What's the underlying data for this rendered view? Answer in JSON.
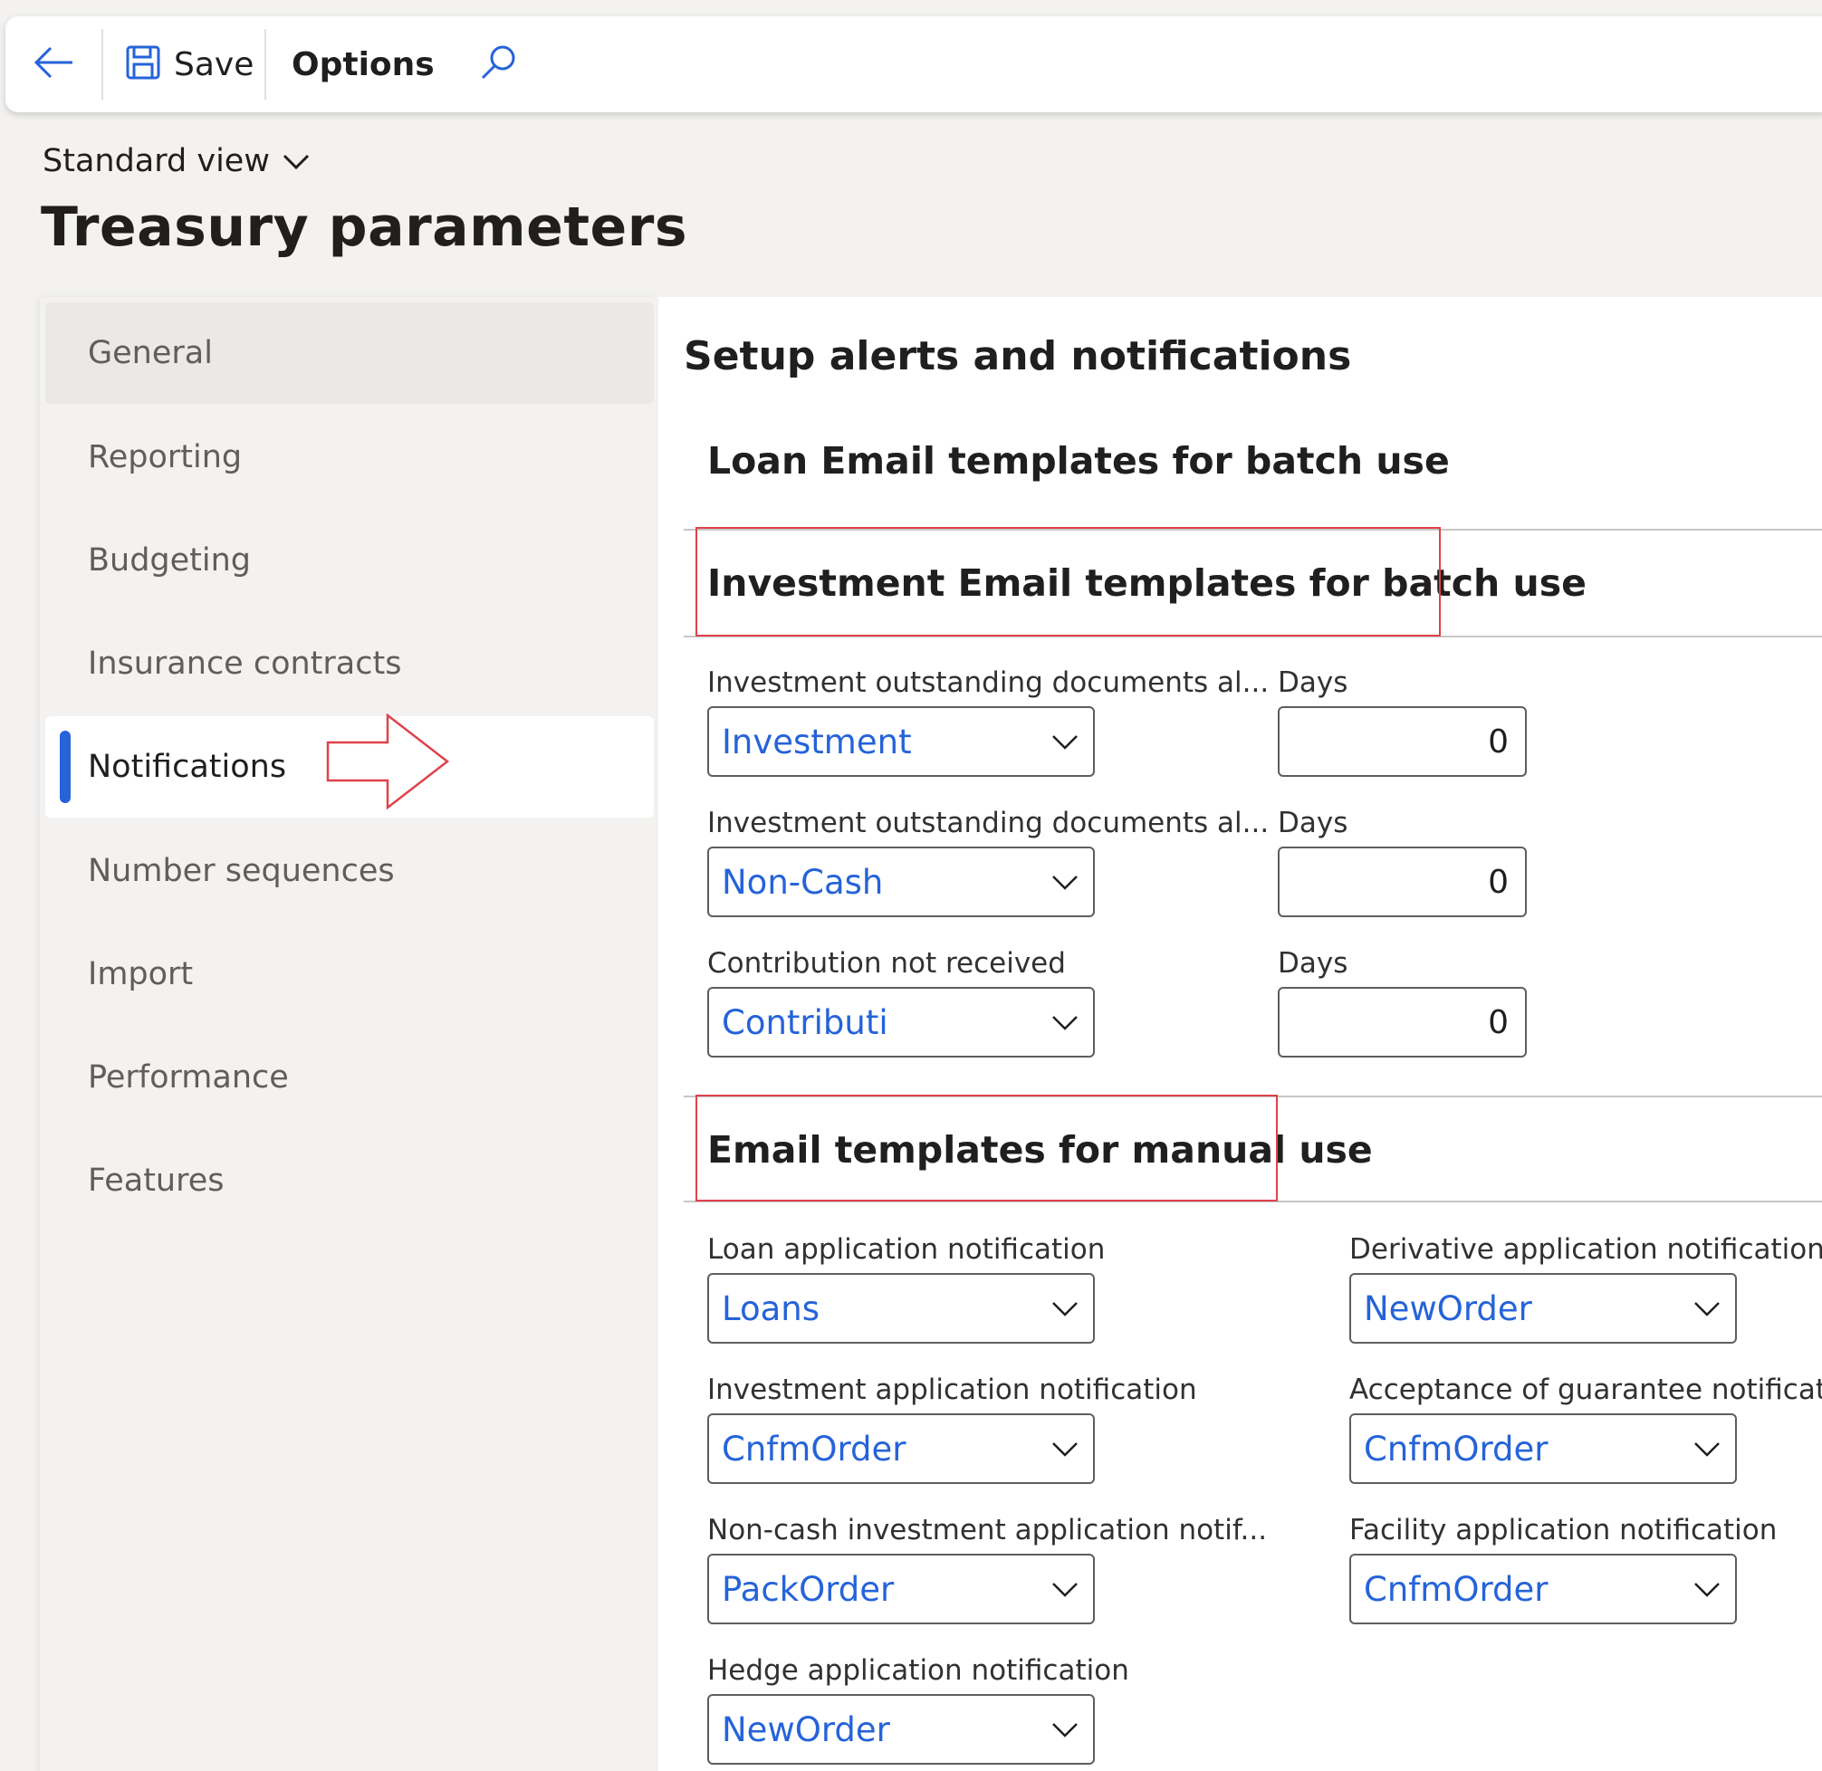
{
  "toolbar": {
    "back": "back-arrow",
    "save_label": "Save",
    "options_label": "Options",
    "search": "search-icon"
  },
  "view": {
    "label": "Standard view"
  },
  "page": {
    "title": "Treasury parameters"
  },
  "nav": {
    "items": [
      {
        "label": "General"
      },
      {
        "label": "Reporting"
      },
      {
        "label": "Budgeting"
      },
      {
        "label": "Insurance contracts"
      },
      {
        "label": "Notifications"
      },
      {
        "label": "Number sequences"
      },
      {
        "label": "Import"
      },
      {
        "label": "Performance"
      },
      {
        "label": "Features"
      }
    ],
    "selected": "Notifications"
  },
  "content": {
    "title": "Setup alerts and notifications",
    "loan_group": "Loan Email templates for batch use",
    "investment_group": "Investment Email templates for batch use",
    "investment_fields": [
      {
        "label": "Investment outstanding documents al...",
        "value": "Investment",
        "days_label": "Days",
        "days": "0"
      },
      {
        "label": "Investment outstanding documents al...",
        "value": "Non-Cash",
        "days_label": "Days",
        "days": "0"
      },
      {
        "label": "Contribution not received",
        "value": "Contributi",
        "days_label": "Days",
        "days": "0"
      }
    ],
    "manual_group": "Email templates for manual use",
    "manual_left": [
      {
        "label": "Loan application notification",
        "value": "Loans"
      },
      {
        "label": "Investment application notification",
        "value": "CnfmOrder"
      },
      {
        "label": "Non-cash investment application notif...",
        "value": "PackOrder"
      },
      {
        "label": "Hedge application notification",
        "value": "NewOrder"
      }
    ],
    "manual_right": [
      {
        "label": "Derivative application notification",
        "value": "NewOrder"
      },
      {
        "label": "Acceptance of guarantee notification",
        "value": "CnfmOrder"
      },
      {
        "label": "Facility application notification",
        "value": "CnfmOrder"
      }
    ]
  },
  "colors": {
    "accent": "#2563d9",
    "annotation": "#e0424c"
  }
}
